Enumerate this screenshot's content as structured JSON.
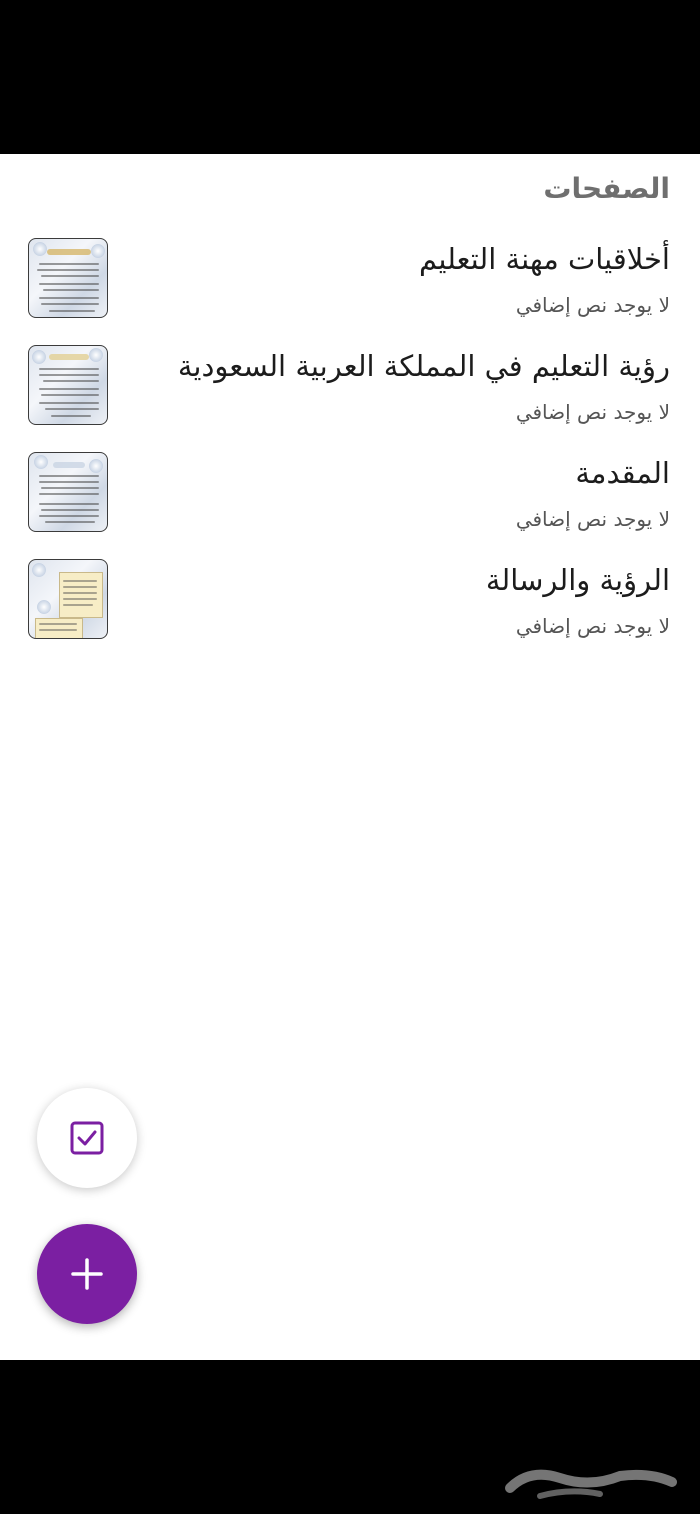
{
  "section": {
    "title": "الصفحات"
  },
  "pages": [
    {
      "title": "أخلاقيات مهنة التعليم",
      "subtitle": "لا يوجد نص إضافي"
    },
    {
      "title": "رؤية التعليم في المملكة العربية السعودية",
      "subtitle": "لا يوجد نص إضافي"
    },
    {
      "title": "المقدمة",
      "subtitle": "لا يوجد نص إضافي"
    },
    {
      "title": "الرؤية والرسالة",
      "subtitle": "لا يوجد نص إضافي"
    }
  ],
  "fabs": {
    "select_icon": "checkbox-icon",
    "add_icon": "plus-icon"
  },
  "colors": {
    "accent": "#7b1fa2",
    "background": "#ffffff",
    "title_text": "#1c1c1c",
    "subtitle_text": "#555555",
    "section_text": "#6f6f6f"
  }
}
